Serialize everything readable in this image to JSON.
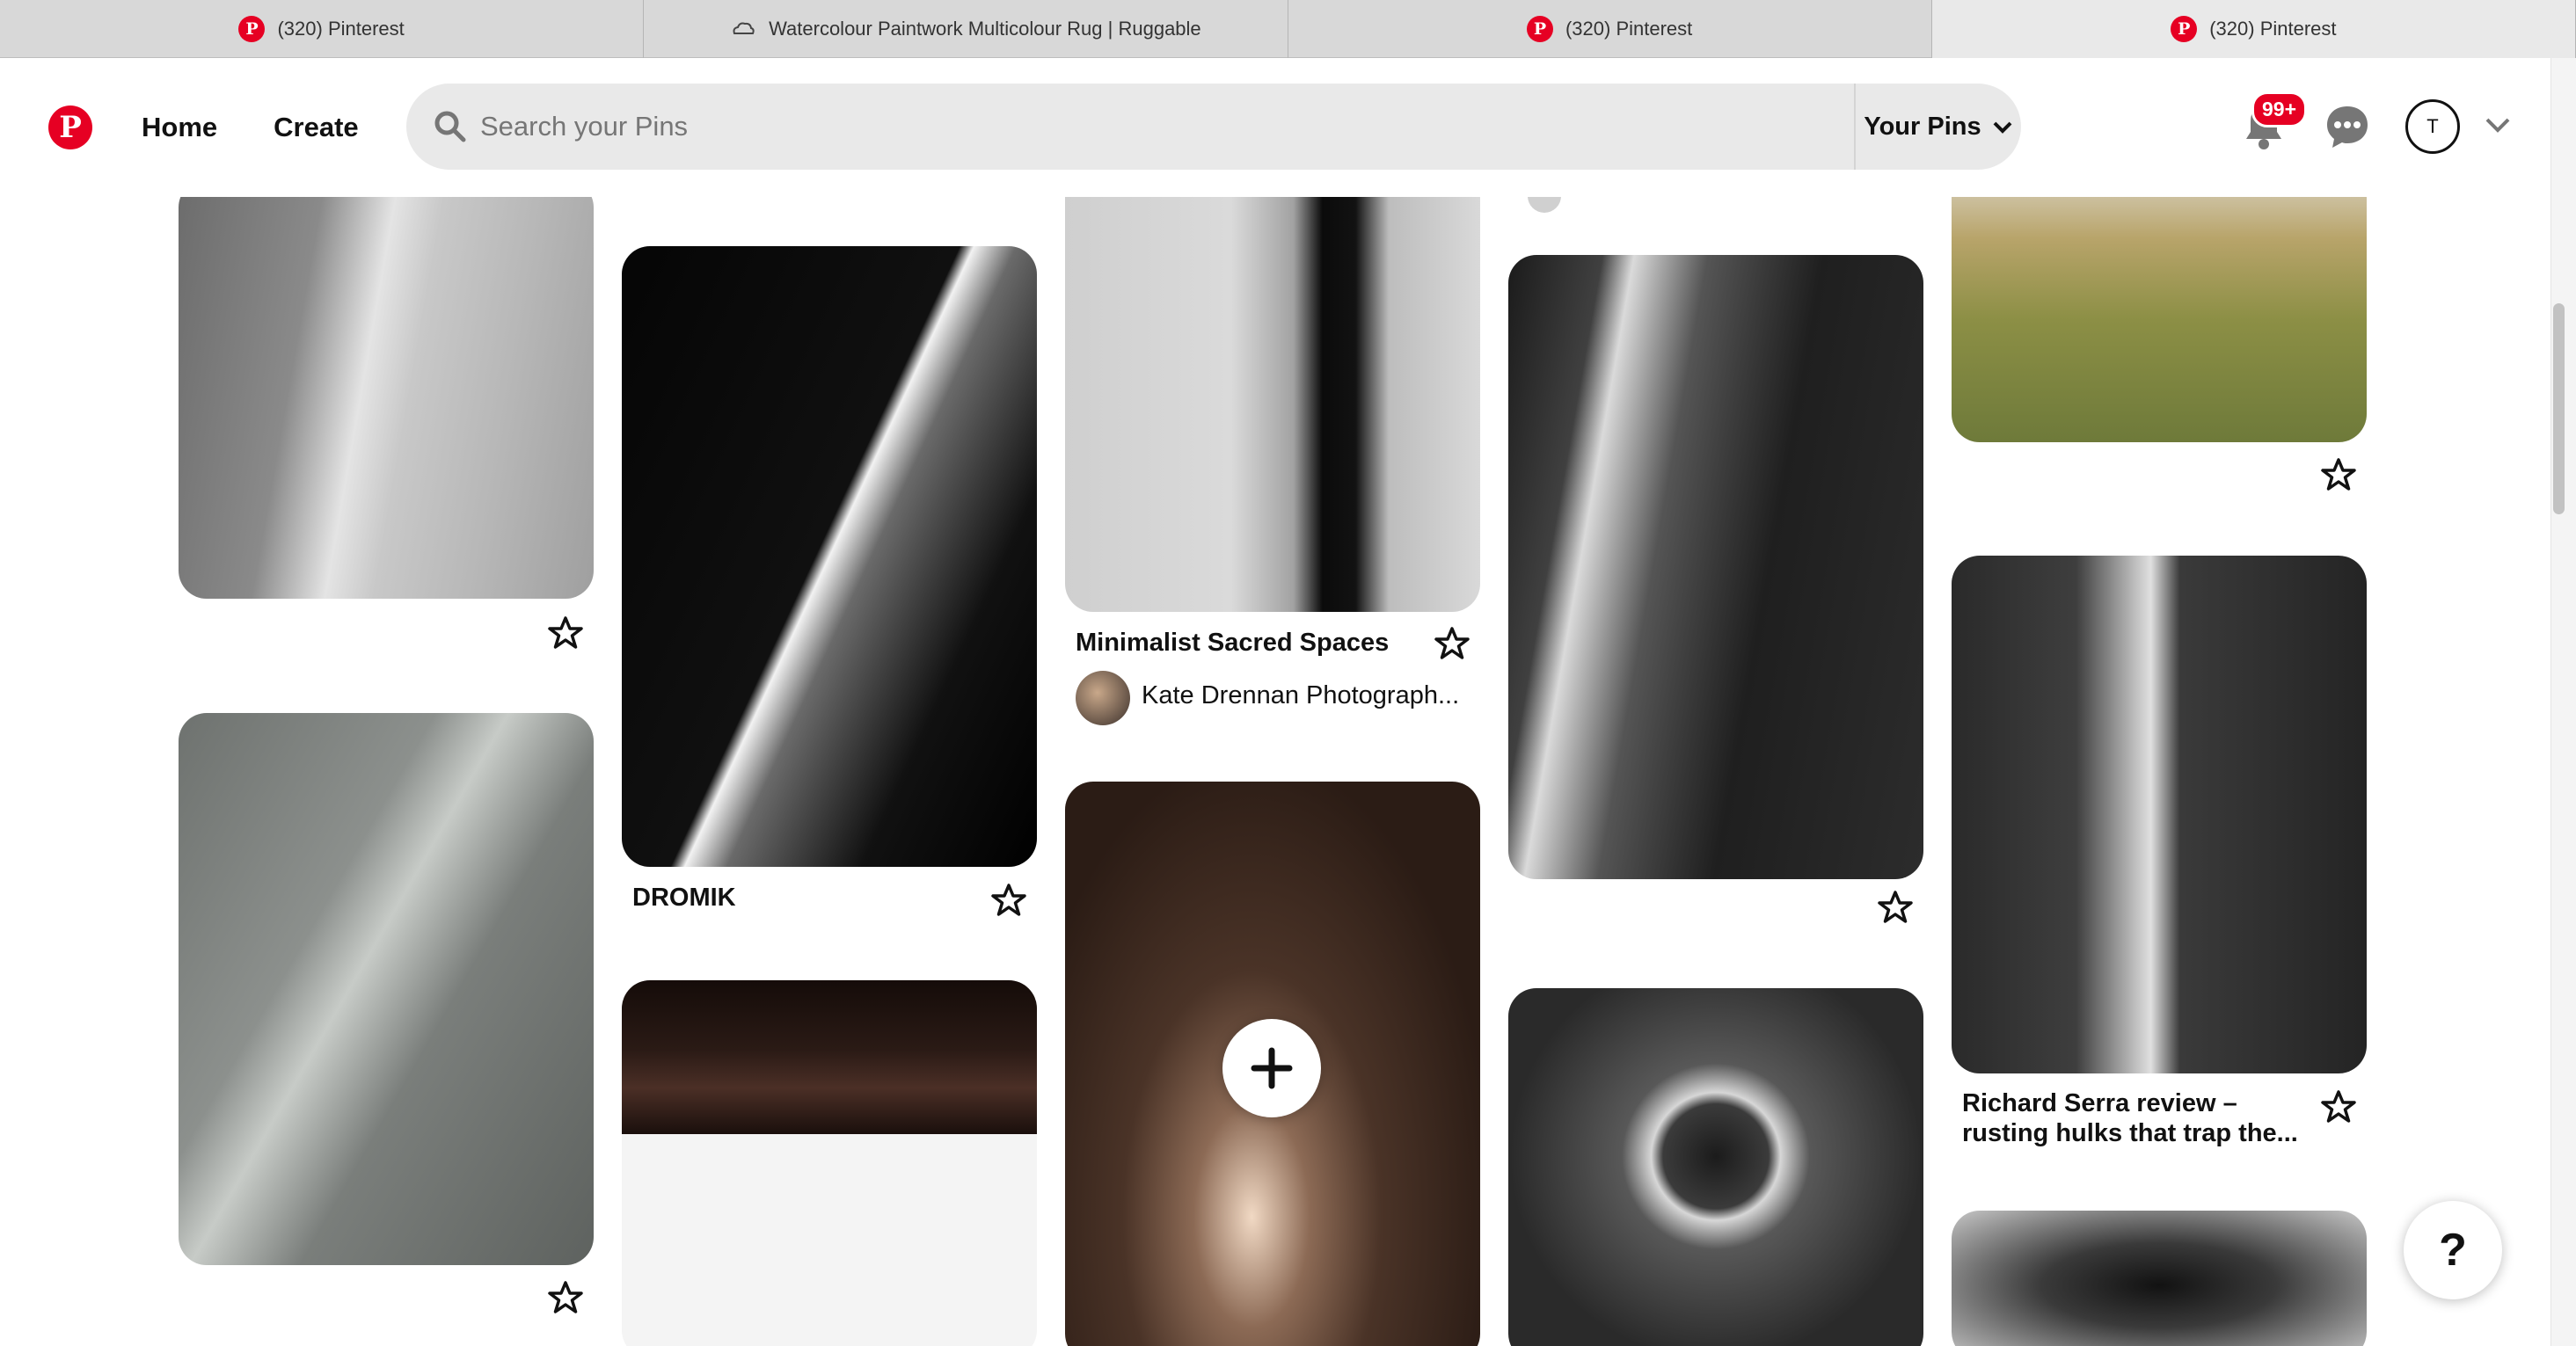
{
  "browser": {
    "tabs": [
      {
        "title": "(320) Pinterest",
        "icon": "pinterest-icon",
        "active": false
      },
      {
        "title": "Watercolour Paintwork Multicolour Rug | Ruggable",
        "icon": "cloud-icon",
        "active": false
      },
      {
        "title": "(320) Pinterest",
        "icon": "pinterest-icon",
        "active": false
      },
      {
        "title": "(320) Pinterest",
        "icon": "pinterest-icon",
        "active": true
      }
    ]
  },
  "header": {
    "home_label": "Home",
    "create_label": "Create",
    "search_placeholder": "Search your Pins",
    "scope_label": "Your Pins",
    "notifications_badge": "99+",
    "avatar_initial": "T"
  },
  "pins": {
    "p3": {
      "title": "Minimalist Sacred Spaces",
      "user": "Kate Drennan Photograph..."
    },
    "p2": {
      "title": "DROMIK"
    },
    "p10": {
      "title_line1": "Richard Serra review –",
      "title_line2": "rusting hulks that trap the..."
    }
  },
  "help_label": "?",
  "colors": {
    "brand": "#e60023",
    "search_bg": "#e9e9e9"
  }
}
